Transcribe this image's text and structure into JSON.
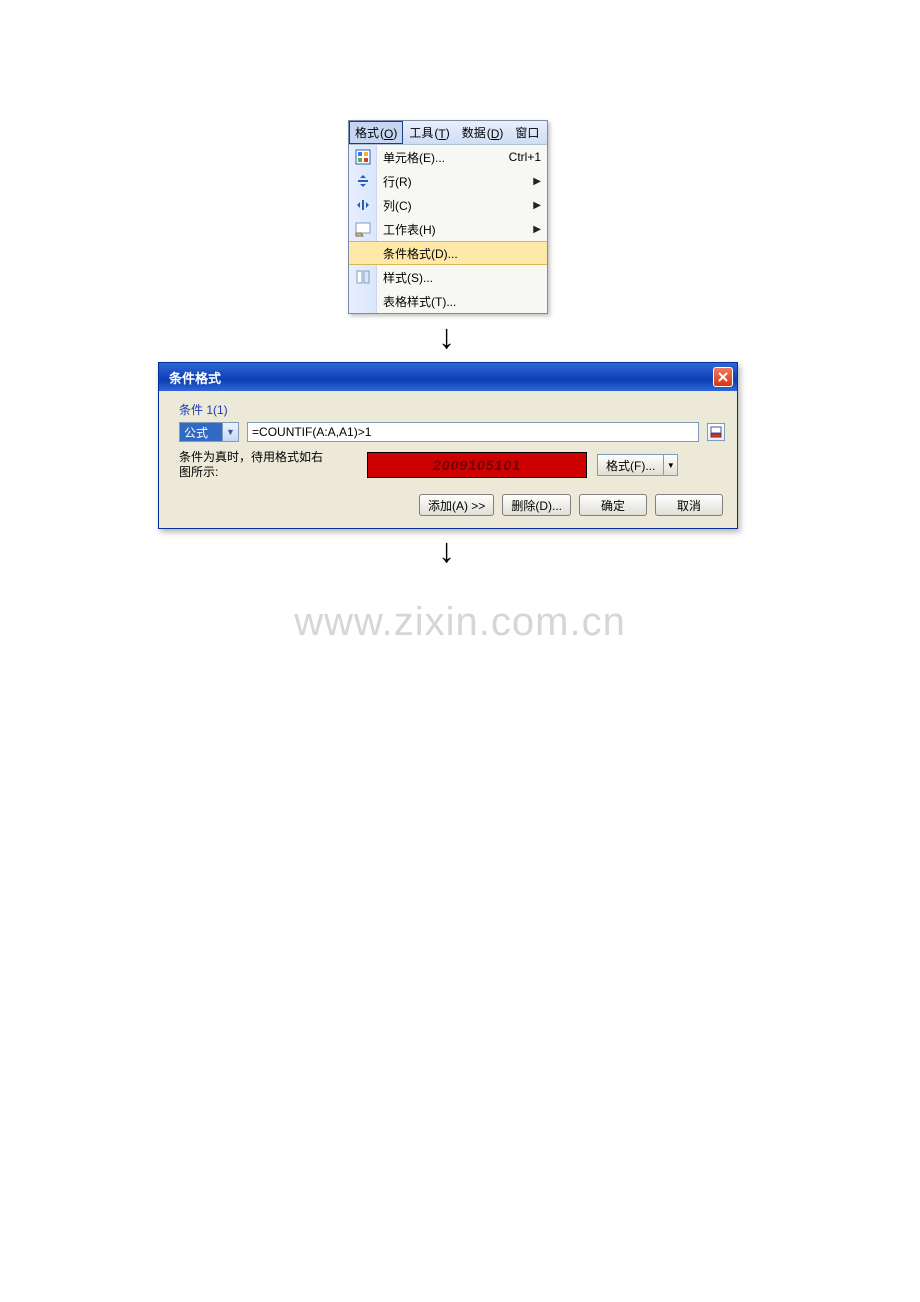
{
  "menubar": {
    "items": [
      {
        "label": "格式",
        "key": "O"
      },
      {
        "label": "工具",
        "key": "T"
      },
      {
        "label": "数据",
        "key": "D"
      },
      {
        "label": "窗口",
        "key": ""
      }
    ]
  },
  "menu": {
    "items": [
      {
        "label": "单元格(E)...",
        "shortcut": "Ctrl+1",
        "arrow": false,
        "icon": "cells-icon"
      },
      {
        "label": "行(R)",
        "shortcut": "",
        "arrow": true,
        "icon": "row-height-icon"
      },
      {
        "label": "列(C)",
        "shortcut": "",
        "arrow": true,
        "icon": "column-width-icon"
      },
      {
        "label": "工作表(H)",
        "shortcut": "",
        "arrow": true,
        "icon": "sheet-tab-icon"
      },
      {
        "label": "条件格式(D)...",
        "shortcut": "",
        "arrow": false,
        "icon": "",
        "highlight": true
      },
      {
        "label": "样式(S)...",
        "shortcut": "",
        "arrow": false,
        "icon": "styles-icon"
      },
      {
        "label": "表格样式(T)...",
        "shortcut": "",
        "arrow": false,
        "icon": ""
      }
    ]
  },
  "dialog": {
    "title": "条件格式",
    "group_label": "条件 1(1)",
    "dropdown_value": "公式",
    "formula": "=COUNTIF(A:A,A1)>1",
    "desc_line1": "条件为真时，待用格式如右",
    "desc_line2": "图所示:",
    "preview_value": "2009105101",
    "format_btn": "格式(F)...",
    "buttons": {
      "add": "添加(A) >>",
      "delete": "删除(D)...",
      "ok": "确定",
      "cancel": "取消"
    }
  },
  "watermark": "www.zixin.com.cn"
}
